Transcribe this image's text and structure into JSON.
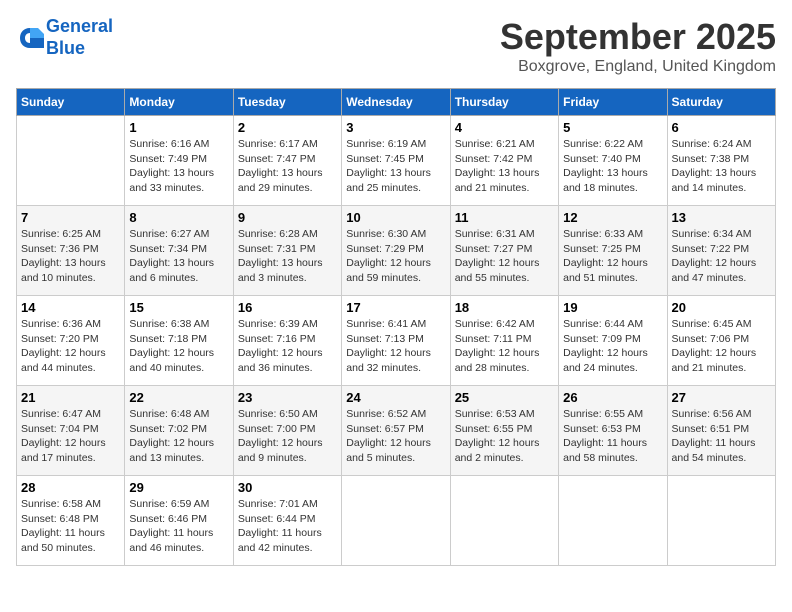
{
  "header": {
    "logo_line1": "General",
    "logo_line2": "Blue",
    "month_title": "September 2025",
    "location": "Boxgrove, England, United Kingdom"
  },
  "weekdays": [
    "Sunday",
    "Monday",
    "Tuesday",
    "Wednesday",
    "Thursday",
    "Friday",
    "Saturday"
  ],
  "weeks": [
    [
      {
        "day": "",
        "sunrise": "",
        "sunset": "",
        "daylight": ""
      },
      {
        "day": "1",
        "sunrise": "Sunrise: 6:16 AM",
        "sunset": "Sunset: 7:49 PM",
        "daylight": "Daylight: 13 hours and 33 minutes."
      },
      {
        "day": "2",
        "sunrise": "Sunrise: 6:17 AM",
        "sunset": "Sunset: 7:47 PM",
        "daylight": "Daylight: 13 hours and 29 minutes."
      },
      {
        "day": "3",
        "sunrise": "Sunrise: 6:19 AM",
        "sunset": "Sunset: 7:45 PM",
        "daylight": "Daylight: 13 hours and 25 minutes."
      },
      {
        "day": "4",
        "sunrise": "Sunrise: 6:21 AM",
        "sunset": "Sunset: 7:42 PM",
        "daylight": "Daylight: 13 hours and 21 minutes."
      },
      {
        "day": "5",
        "sunrise": "Sunrise: 6:22 AM",
        "sunset": "Sunset: 7:40 PM",
        "daylight": "Daylight: 13 hours and 18 minutes."
      },
      {
        "day": "6",
        "sunrise": "Sunrise: 6:24 AM",
        "sunset": "Sunset: 7:38 PM",
        "daylight": "Daylight: 13 hours and 14 minutes."
      }
    ],
    [
      {
        "day": "7",
        "sunrise": "Sunrise: 6:25 AM",
        "sunset": "Sunset: 7:36 PM",
        "daylight": "Daylight: 13 hours and 10 minutes."
      },
      {
        "day": "8",
        "sunrise": "Sunrise: 6:27 AM",
        "sunset": "Sunset: 7:34 PM",
        "daylight": "Daylight: 13 hours and 6 minutes."
      },
      {
        "day": "9",
        "sunrise": "Sunrise: 6:28 AM",
        "sunset": "Sunset: 7:31 PM",
        "daylight": "Daylight: 13 hours and 3 minutes."
      },
      {
        "day": "10",
        "sunrise": "Sunrise: 6:30 AM",
        "sunset": "Sunset: 7:29 PM",
        "daylight": "Daylight: 12 hours and 59 minutes."
      },
      {
        "day": "11",
        "sunrise": "Sunrise: 6:31 AM",
        "sunset": "Sunset: 7:27 PM",
        "daylight": "Daylight: 12 hours and 55 minutes."
      },
      {
        "day": "12",
        "sunrise": "Sunrise: 6:33 AM",
        "sunset": "Sunset: 7:25 PM",
        "daylight": "Daylight: 12 hours and 51 minutes."
      },
      {
        "day": "13",
        "sunrise": "Sunrise: 6:34 AM",
        "sunset": "Sunset: 7:22 PM",
        "daylight": "Daylight: 12 hours and 47 minutes."
      }
    ],
    [
      {
        "day": "14",
        "sunrise": "Sunrise: 6:36 AM",
        "sunset": "Sunset: 7:20 PM",
        "daylight": "Daylight: 12 hours and 44 minutes."
      },
      {
        "day": "15",
        "sunrise": "Sunrise: 6:38 AM",
        "sunset": "Sunset: 7:18 PM",
        "daylight": "Daylight: 12 hours and 40 minutes."
      },
      {
        "day": "16",
        "sunrise": "Sunrise: 6:39 AM",
        "sunset": "Sunset: 7:16 PM",
        "daylight": "Daylight: 12 hours and 36 minutes."
      },
      {
        "day": "17",
        "sunrise": "Sunrise: 6:41 AM",
        "sunset": "Sunset: 7:13 PM",
        "daylight": "Daylight: 12 hours and 32 minutes."
      },
      {
        "day": "18",
        "sunrise": "Sunrise: 6:42 AM",
        "sunset": "Sunset: 7:11 PM",
        "daylight": "Daylight: 12 hours and 28 minutes."
      },
      {
        "day": "19",
        "sunrise": "Sunrise: 6:44 AM",
        "sunset": "Sunset: 7:09 PM",
        "daylight": "Daylight: 12 hours and 24 minutes."
      },
      {
        "day": "20",
        "sunrise": "Sunrise: 6:45 AM",
        "sunset": "Sunset: 7:06 PM",
        "daylight": "Daylight: 12 hours and 21 minutes."
      }
    ],
    [
      {
        "day": "21",
        "sunrise": "Sunrise: 6:47 AM",
        "sunset": "Sunset: 7:04 PM",
        "daylight": "Daylight: 12 hours and 17 minutes."
      },
      {
        "day": "22",
        "sunrise": "Sunrise: 6:48 AM",
        "sunset": "Sunset: 7:02 PM",
        "daylight": "Daylight: 12 hours and 13 minutes."
      },
      {
        "day": "23",
        "sunrise": "Sunrise: 6:50 AM",
        "sunset": "Sunset: 7:00 PM",
        "daylight": "Daylight: 12 hours and 9 minutes."
      },
      {
        "day": "24",
        "sunrise": "Sunrise: 6:52 AM",
        "sunset": "Sunset: 6:57 PM",
        "daylight": "Daylight: 12 hours and 5 minutes."
      },
      {
        "day": "25",
        "sunrise": "Sunrise: 6:53 AM",
        "sunset": "Sunset: 6:55 PM",
        "daylight": "Daylight: 12 hours and 2 minutes."
      },
      {
        "day": "26",
        "sunrise": "Sunrise: 6:55 AM",
        "sunset": "Sunset: 6:53 PM",
        "daylight": "Daylight: 11 hours and 58 minutes."
      },
      {
        "day": "27",
        "sunrise": "Sunrise: 6:56 AM",
        "sunset": "Sunset: 6:51 PM",
        "daylight": "Daylight: 11 hours and 54 minutes."
      }
    ],
    [
      {
        "day": "28",
        "sunrise": "Sunrise: 6:58 AM",
        "sunset": "Sunset: 6:48 PM",
        "daylight": "Daylight: 11 hours and 50 minutes."
      },
      {
        "day": "29",
        "sunrise": "Sunrise: 6:59 AM",
        "sunset": "Sunset: 6:46 PM",
        "daylight": "Daylight: 11 hours and 46 minutes."
      },
      {
        "day": "30",
        "sunrise": "Sunrise: 7:01 AM",
        "sunset": "Sunset: 6:44 PM",
        "daylight": "Daylight: 11 hours and 42 minutes."
      },
      {
        "day": "",
        "sunrise": "",
        "sunset": "",
        "daylight": ""
      },
      {
        "day": "",
        "sunrise": "",
        "sunset": "",
        "daylight": ""
      },
      {
        "day": "",
        "sunrise": "",
        "sunset": "",
        "daylight": ""
      },
      {
        "day": "",
        "sunrise": "",
        "sunset": "",
        "daylight": ""
      }
    ]
  ]
}
